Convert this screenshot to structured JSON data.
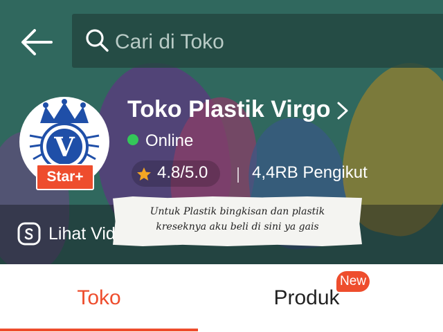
{
  "search": {
    "placeholder": "Cari di Toko"
  },
  "shop": {
    "name": "Toko Plastik Virgo",
    "badge": "Star+",
    "logo_letter": "V",
    "status": "Online",
    "rating": "4.8/5.0",
    "followers": "4,4RB Pengikut"
  },
  "video_link": {
    "label": "Lihat Vid"
  },
  "caption": {
    "line1": "Untuk Plastik bingkisan dan plastik",
    "line2": "kreseknya aku beli di sini ya gais"
  },
  "tabs": [
    {
      "label": "Toko",
      "active": true
    },
    {
      "label": "Produk",
      "active": false,
      "badge": "New"
    }
  ],
  "colors": {
    "accent": "#ee4d2d",
    "online": "#34c759",
    "star": "#f5a623",
    "logo_blue": "#1f4fa8"
  },
  "icons": [
    "back-arrow-icon",
    "search-icon",
    "chevron-right-icon",
    "star-icon",
    "video-play-icon"
  ]
}
